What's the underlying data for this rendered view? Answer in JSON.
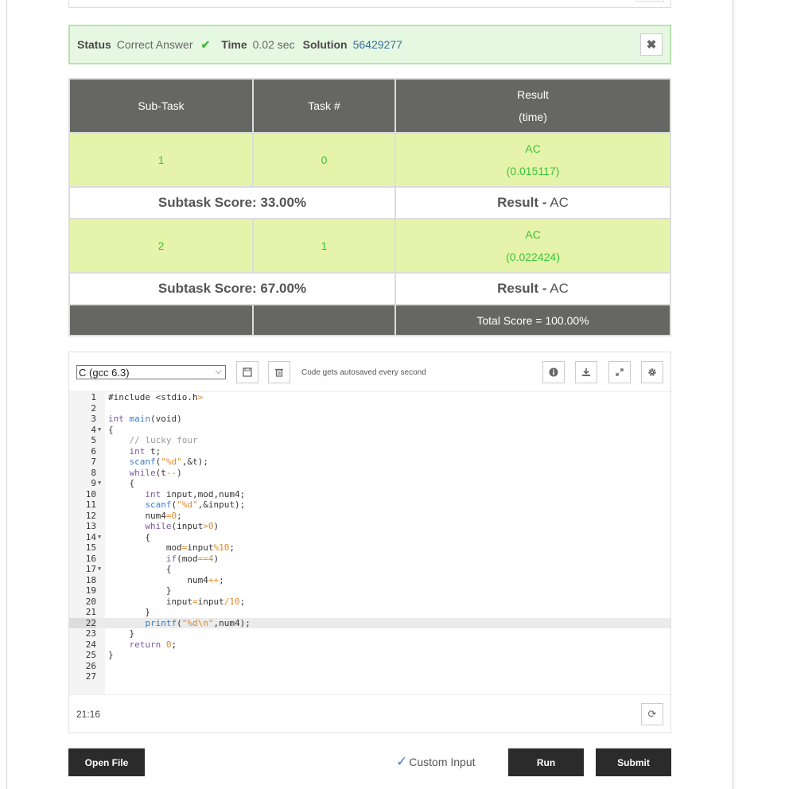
{
  "status": {
    "status_label": "Status",
    "status_value": "Correct Answer",
    "time_label": "Time",
    "time_value": "0.02 sec",
    "solution_label": "Solution",
    "solution_value": "56429277",
    "check_icon": "check-icon",
    "close_icon": "close-icon",
    "accent_color": "#3fb83f"
  },
  "results": {
    "headers": [
      "Sub-Task",
      "Task #",
      "Result",
      "(time)"
    ],
    "rows": [
      {
        "subtask": "1",
        "task": "0",
        "result": "AC",
        "time": "(0.015117)"
      },
      {
        "subtask": "2",
        "task": "1",
        "result": "AC",
        "time": "(0.022424)"
      }
    ],
    "subtask_scores": [
      {
        "score_text": "Subtask Score: 33.00%",
        "result_label": "Result -",
        "result_value": "AC"
      },
      {
        "score_text": "Subtask Score: 67.00%",
        "result_label": "Result -",
        "result_value": "AC"
      }
    ],
    "total": "Total Score = 100.00%"
  },
  "editor": {
    "language": "C (gcc 6.3)",
    "autosave_note": "Code gets autosaved every second",
    "cursor_position": "21:16",
    "active_line": 22,
    "icons": [
      "save-icon",
      "trash-icon",
      "info-icon",
      "download-icon",
      "expand-icon",
      "gear-icon",
      "refresh-icon"
    ],
    "lines": [
      "#include <stdio.h>",
      "",
      "int main(void)",
      "{",
      "    // lucky four",
      "    int t;",
      "    scanf(\"%d\",&t);",
      "    while(t--)",
      "    {",
      "       int input,mod,num4;",
      "       scanf(\"%d\",&input);",
      "       num4=0;",
      "       while(input>0)",
      "       {",
      "           mod=input%10;",
      "           if(mod==4)",
      "           {",
      "               num4++;",
      "           }",
      "           input=input/10;",
      "       }",
      "       printf(\"%d\\n\",num4);",
      "    }",
      "    return 0;",
      "}",
      "",
      ""
    ]
  },
  "actions": {
    "open_file": "Open File",
    "custom_input": "Custom Input",
    "run": "Run",
    "submit": "Submit"
  }
}
